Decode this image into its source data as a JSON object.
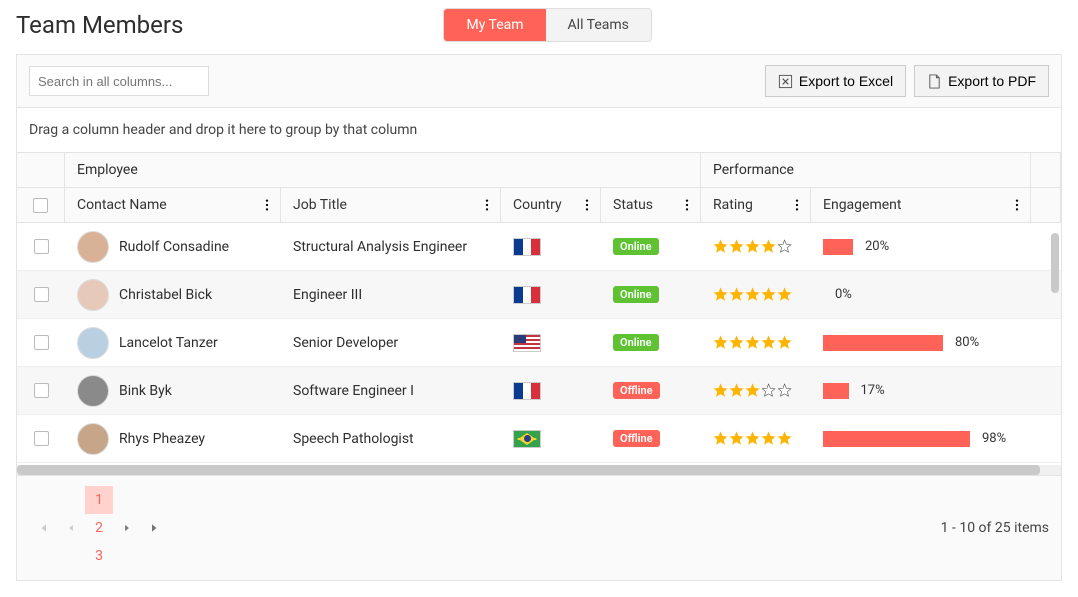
{
  "header": {
    "title": "Team Members",
    "tabs": [
      {
        "label": "My Team",
        "active": true
      },
      {
        "label": "All Teams",
        "active": false
      }
    ]
  },
  "toolbar": {
    "search_placeholder": "Search in all columns...",
    "export_excel_label": "Export to Excel",
    "export_pdf_label": "Export to PDF"
  },
  "group_hint": "Drag a column header and drop it here to group by that column",
  "columns": {
    "group_employee": "Employee",
    "group_performance": "Performance",
    "contact_name": "Contact Name",
    "job_title": "Job Title",
    "country": "Country",
    "status": "Status",
    "rating": "Rating",
    "engagement": "Engagement"
  },
  "status_labels": {
    "online": "Online",
    "offline": "Offline"
  },
  "rows": [
    {
      "name": "Rudolf Consadine",
      "avatar_color": "#d9b197",
      "job": "Structural Analysis Engineer",
      "country": "fr",
      "status": "online",
      "rating": 4,
      "engagement": 20
    },
    {
      "name": "Christabel Bick",
      "avatar_color": "#e7c9b9",
      "job": "Engineer III",
      "country": "fr",
      "status": "online",
      "rating": 5,
      "engagement": 0
    },
    {
      "name": "Lancelot Tanzer",
      "avatar_color": "#b9cfe2",
      "job": "Senior Developer",
      "country": "us",
      "status": "online",
      "rating": 5,
      "engagement": 80
    },
    {
      "name": "Bink Byk",
      "avatar_color": "#8a8a8a",
      "job": "Software Engineer I",
      "country": "fr",
      "status": "offline",
      "rating": 3,
      "engagement": 17
    },
    {
      "name": "Rhys Pheazey",
      "avatar_color": "#c7a589",
      "job": "Speech Pathologist",
      "country": "br",
      "status": "offline",
      "rating": 5,
      "engagement": 98
    }
  ],
  "pager": {
    "pages": [
      "1",
      "2",
      "3"
    ],
    "active_page": 1,
    "info": "1 - 10 of 25 items"
  }
}
